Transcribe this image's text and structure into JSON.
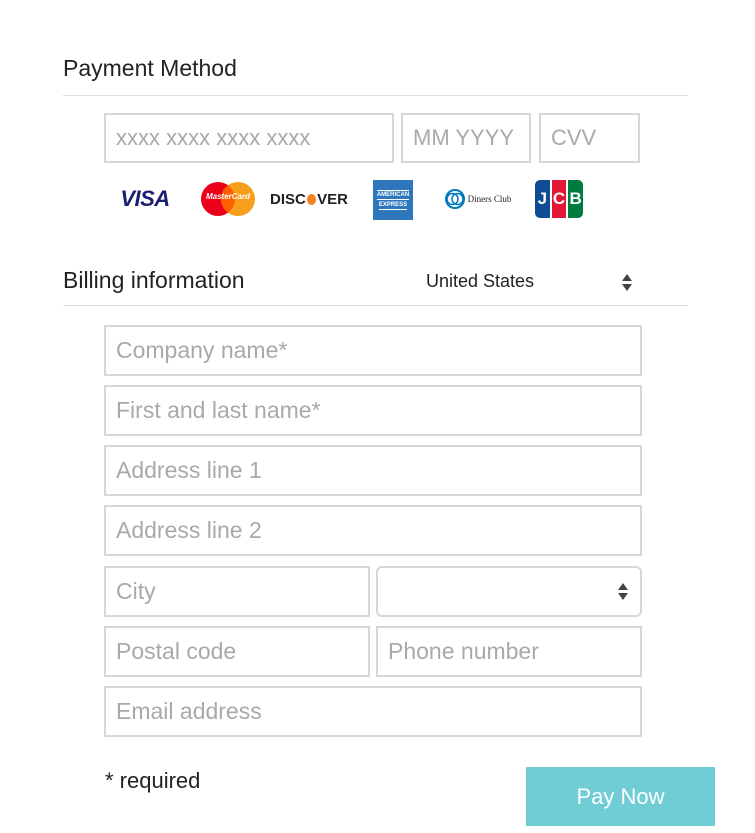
{
  "payment": {
    "title": "Payment Method",
    "card_number_placeholder": "xxxx xxxx xxxx xxxx",
    "expiry_placeholder": "MM YYYY",
    "cvv_placeholder": "CVV",
    "card_logos": {
      "visa": "VISA",
      "mastercard": "MasterCard",
      "discover_a": "DISC",
      "discover_b": "VER",
      "amex_a": "AMERICAN",
      "amex_b": "EXPRESS",
      "diners": "Diners Club",
      "jcb": [
        "J",
        "C",
        "B"
      ]
    }
  },
  "billing": {
    "title": "Billing information",
    "country": "United States",
    "company_placeholder": "Company name*",
    "name_placeholder": "First and last name*",
    "address1_placeholder": "Address line 1",
    "address2_placeholder": "Address line 2",
    "city_placeholder": "City",
    "state_value": "",
    "postal_placeholder": "Postal code",
    "phone_placeholder": "Phone number",
    "email_placeholder": "Email address"
  },
  "footer": {
    "required_note": "* required",
    "pay_button": "Pay Now"
  },
  "colors": {
    "pay_button": "#70cdd6",
    "visa_blue": "#1a1f71",
    "mastercard_red": "#eb001b",
    "mastercard_orange": "#f79e1b",
    "discover_orange": "#f58220",
    "amex_blue": "#2e77bc",
    "jcb_blue": "#0e4c96",
    "jcb_red": "#e21836",
    "jcb_green": "#007b40"
  }
}
